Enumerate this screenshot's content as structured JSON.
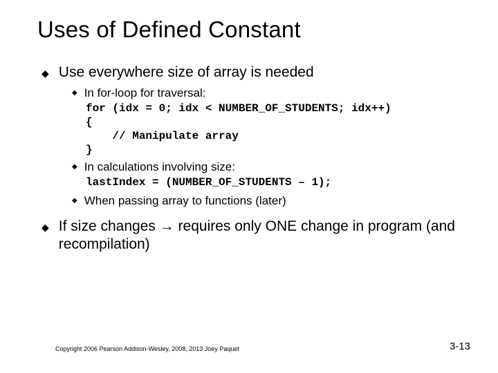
{
  "title": "Uses of Defined Constant",
  "bullets": [
    {
      "text": "Use everywhere size of array is needed",
      "sub": [
        {
          "text": "In for-loop for traversal:",
          "code": [
            "for (idx = 0; idx < NUMBER_OF_STUDENTS; idx++)",
            "{",
            "    // Manipulate array",
            "}"
          ]
        },
        {
          "text": "In calculations involving size:",
          "code": [
            "lastIndex = (NUMBER_OF_STUDENTS – 1);"
          ]
        },
        {
          "text": "When passing array to functions (later)"
        }
      ]
    },
    {
      "pre": "If size changes ",
      "arrow": "→",
      "post": " requires only ONE change in program (and recompilation)"
    }
  ],
  "footer": {
    "copyright": "Copyright  2006 Pearson Addison-Wesley, 2008, 2013 Joey Paquet",
    "page": "3-13"
  }
}
